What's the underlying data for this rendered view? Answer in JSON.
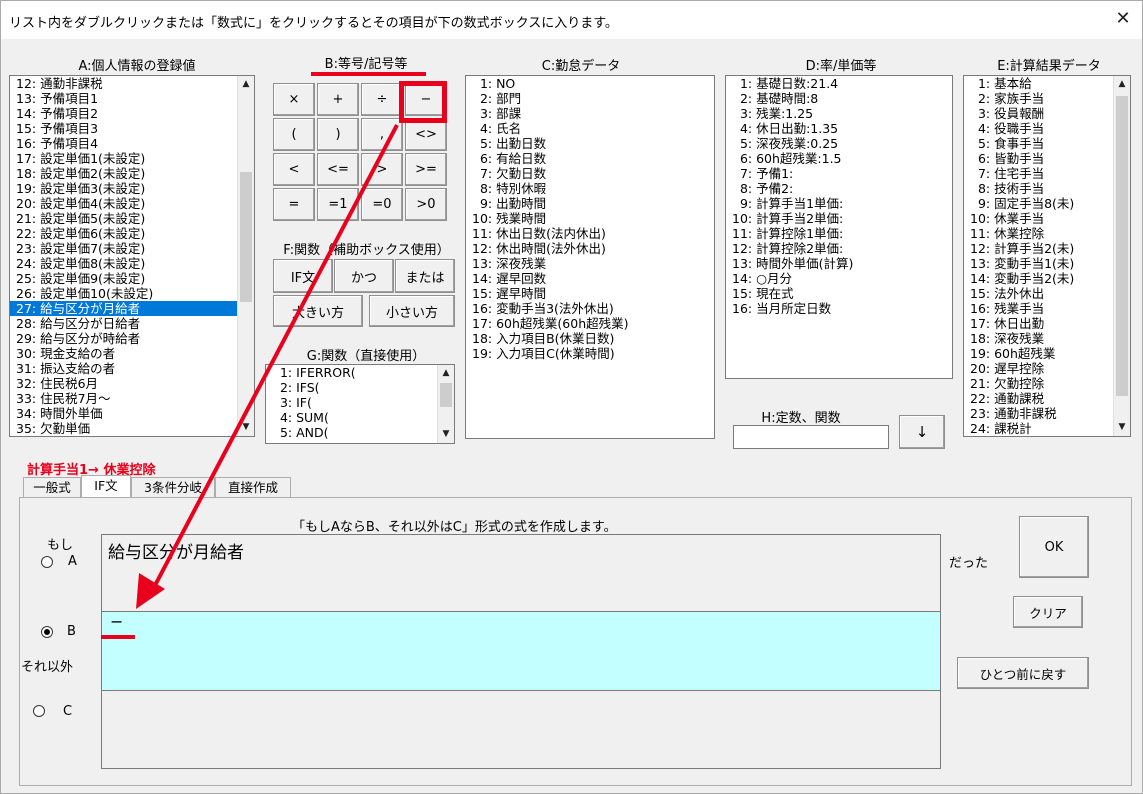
{
  "window": {
    "title": "リスト内をダブルクリックまたは「数式に」をクリックするとその項目が下の数式ボックスに入ります。",
    "close_label": "✕"
  },
  "headers": {
    "a": "A:個人情報の登録値",
    "b": "B:等号/記号等",
    "c": "C:勤怠データ",
    "d": "D:率/単価等",
    "e": "E:計算結果データ",
    "f": "F:関数（補助ボックス使用）",
    "g": "G:関数（直接使用）",
    "h": "H:定数、関数"
  },
  "list_a": {
    "items": [
      "12: 通勤非課税",
      "13: 予備項目1",
      "14: 予備項目2",
      "15: 予備項目3",
      "16: 予備項目4",
      "17: 設定単価1(未設定)",
      "18: 設定単価2(未設定)",
      "19: 設定単価3(未設定)",
      "20: 設定単価4(未設定)",
      "21: 設定単価5(未設定)",
      "22: 設定単価6(未設定)",
      "23: 設定単価7(未設定)",
      "24: 設定単価8(未設定)",
      "25: 設定単価9(未設定)",
      "26: 設定単価10(未設定)",
      "27: 給与区分が月給者",
      "28: 給与区分が日給者",
      "29: 給与区分が時給者",
      "30: 現金支給の者",
      "31: 振込支給の者",
      "32: 住民税6月",
      "33: 住民税7月～",
      "34: 時間外単価",
      "35: 欠勤単価"
    ],
    "selected_index": 15
  },
  "list_c": {
    "items": [
      "  1: NO",
      "  2: 部門",
      "  3: 部課",
      "  4: 氏名",
      "  5: 出勤日数",
      "  6: 有給日数",
      "  7: 欠勤日数",
      "  8: 特別休暇",
      "  9: 出勤時間",
      "10: 残業時間",
      "11: 休出日数(法内休出)",
      "12: 休出時間(法外休出)",
      "13: 深夜残業",
      "14: 遅早回数",
      "15: 遅早時間",
      "16: 変動手当3(法外休出)",
      "17: 60h超残業(60h超残業)",
      "18: 入力項目B(休業日数)",
      "19: 入力項目C(休業時間)"
    ]
  },
  "list_d": {
    "items": [
      "  1: 基礎日数:21.4",
      "  2: 基礎時間:8",
      "  3: 残業:1.25",
      "  4: 休日出勤:1.35",
      "  5: 深夜残業:0.25",
      "  6: 60h超残業:1.5",
      "  7: 予備1:",
      "  8: 予備2:",
      "  9: 計算手当1単価:",
      "10: 計算手当2単価:",
      "11: 計算控除1単価:",
      "12: 計算控除2単価:",
      "13: 時間外単価(計算)",
      "14: ○月分",
      "15: 現在式",
      "16: 当月所定日数"
    ]
  },
  "list_e": {
    "items": [
      "  1: 基本給",
      "  2: 家族手当",
      "  3: 役員報酬",
      "  4: 役職手当",
      "  5: 食事手当",
      "  6: 皆勤手当",
      "  7: 住宅手当",
      "  8: 技術手当",
      "  9: 固定手当8(未)",
      "10: 休業手当",
      "11: 休業控除",
      "12: 計算手当2(未)",
      "13: 変動手当1(未)",
      "14: 変動手当2(未)",
      "15: 法外休出",
      "16: 残業手当",
      "17: 休日出勤",
      "18: 深夜残業",
      "19: 60h超残業",
      "20: 遅早控除",
      "21: 欠勤控除",
      "22: 通勤課税",
      "23: 通勤非課税",
      "24: 課税計"
    ]
  },
  "list_g": {
    "items": [
      "  1: IFERROR(",
      "  2: IFS(",
      "  3: IF(",
      "  4: SUM(",
      "  5: AND("
    ]
  },
  "operators": [
    "×",
    "+",
    "÷",
    "−",
    "(",
    ")",
    ",",
    "<>",
    "<",
    "<=",
    ">",
    ">=",
    "=",
    "=1",
    "=0",
    ">0"
  ],
  "func_buttons": {
    "if": "IF文",
    "and": "かつ",
    "or": "または",
    "max": "大きい方",
    "min": "小さい方"
  },
  "constant": {
    "value": "",
    "insert_label": "↓"
  },
  "target_label": "計算手当1→  休業控除",
  "tabs": [
    "一般式",
    "IF文",
    "3条件分岐",
    "直接作成"
  ],
  "active_tab": 1,
  "editor": {
    "description": "「もしAならB、それ以外はC」形式の式を作成します。",
    "if_label": "もし",
    "radio_a": "A",
    "radio_b": "B",
    "radio_c": "C",
    "else_label": "それ以外",
    "then_label": "だった",
    "formula_a": "給与区分が月給者",
    "formula_b": "−",
    "formula_c": "",
    "selected_radio": "B"
  },
  "actions": {
    "ok": "OK",
    "clear": "クリア",
    "undo": "ひとつ前に戻す"
  },
  "colors": {
    "selection": "#0078d7",
    "formula_b_bg": "#c4ffff",
    "annotation_red": "#e8001c"
  }
}
